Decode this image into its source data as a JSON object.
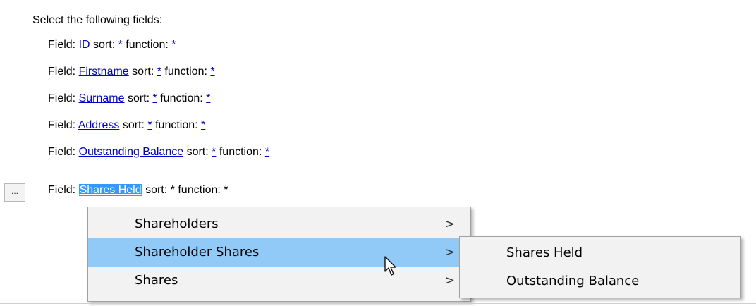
{
  "header": "Select the following fields:",
  "labels": {
    "field": "Field:",
    "sort": "sort:",
    "function": "function:"
  },
  "rows": [
    {
      "name": "ID",
      "sort": "*",
      "function": "*"
    },
    {
      "name": "Firstname",
      "sort": "*",
      "function": "*"
    },
    {
      "name": "Surname",
      "sort": "*",
      "function": "*"
    },
    {
      "name": "Address",
      "sort": "*",
      "function": "*"
    },
    {
      "name": "Outstanding Balance",
      "sort": "*",
      "function": "*"
    }
  ],
  "active_row": {
    "name": "Shares Held",
    "sort": "*",
    "function": "*"
  },
  "ellipsis_label": "...",
  "menu": {
    "items": [
      {
        "label": "Shareholders",
        "arrow": ">"
      },
      {
        "label": "Shareholder Shares",
        "arrow": ">",
        "highlighted": true
      },
      {
        "label": "Shares",
        "arrow": ">"
      }
    ]
  },
  "submenu": {
    "items": [
      {
        "label": "Shares Held"
      },
      {
        "label": "Outstanding Balance"
      }
    ]
  },
  "colors": {
    "link": "#0000cc",
    "selection": "#3399ff",
    "menu_highlight": "#91c9f7",
    "menu_bg": "#f2f2f2"
  }
}
